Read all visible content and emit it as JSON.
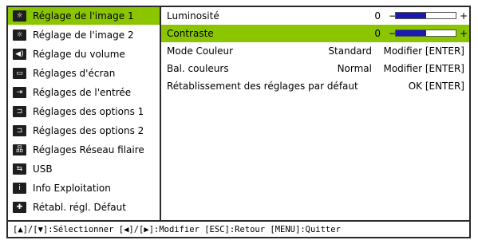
{
  "sidebar": {
    "items": [
      {
        "label": "Réglage de l'image 1",
        "icon": "image-settings-icon",
        "selected": true
      },
      {
        "label": "Réglage de l'image 2",
        "icon": "image-settings-icon",
        "selected": false
      },
      {
        "label": "Réglage du volume",
        "icon": "volume-icon",
        "selected": false
      },
      {
        "label": "Réglages d'écran",
        "icon": "screen-icon",
        "selected": false
      },
      {
        "label": "Réglages de l'entrée",
        "icon": "input-icon",
        "selected": false
      },
      {
        "label": "Réglages des options 1",
        "icon": "options-icon",
        "selected": false
      },
      {
        "label": "Réglages des options 2",
        "icon": "options-icon",
        "selected": false
      },
      {
        "label": "Réglages Réseau filaire",
        "icon": "network-icon",
        "selected": false
      },
      {
        "label": "USB",
        "icon": "usb-icon",
        "selected": false
      },
      {
        "label": "Info Exploitation",
        "icon": "info-icon",
        "selected": false
      },
      {
        "label": "Rétabl. régl. Défaut",
        "icon": "reset-icon",
        "selected": false
      }
    ]
  },
  "main": {
    "brightness": {
      "label": "Luminosité",
      "value": "0",
      "minus": "−",
      "plus": "+",
      "level": 0.5
    },
    "contrast": {
      "label": "Contraste",
      "value": "0",
      "minus": "−",
      "plus": "+",
      "level": 0.5
    },
    "color_mode": {
      "label": "Mode Couleur",
      "value": "Standard",
      "action": "Modifier [ENTER]"
    },
    "color_balance": {
      "label": "Bal. couleurs",
      "value": "Normal",
      "action": "Modifier [ENTER]"
    },
    "reset": {
      "label": "Rétablissement des réglages par défaut",
      "action": "OK [ENTER]"
    }
  },
  "status_bar": {
    "text": "[▲]/[▼]:Sélectionner [◀]/[▶]:Modifier [ESC]:Retour [MENU]:Quitter"
  },
  "colors": {
    "highlight": "#8ac500",
    "slider_fill": "#1a1ab0",
    "frame": "#2a2a2a"
  }
}
